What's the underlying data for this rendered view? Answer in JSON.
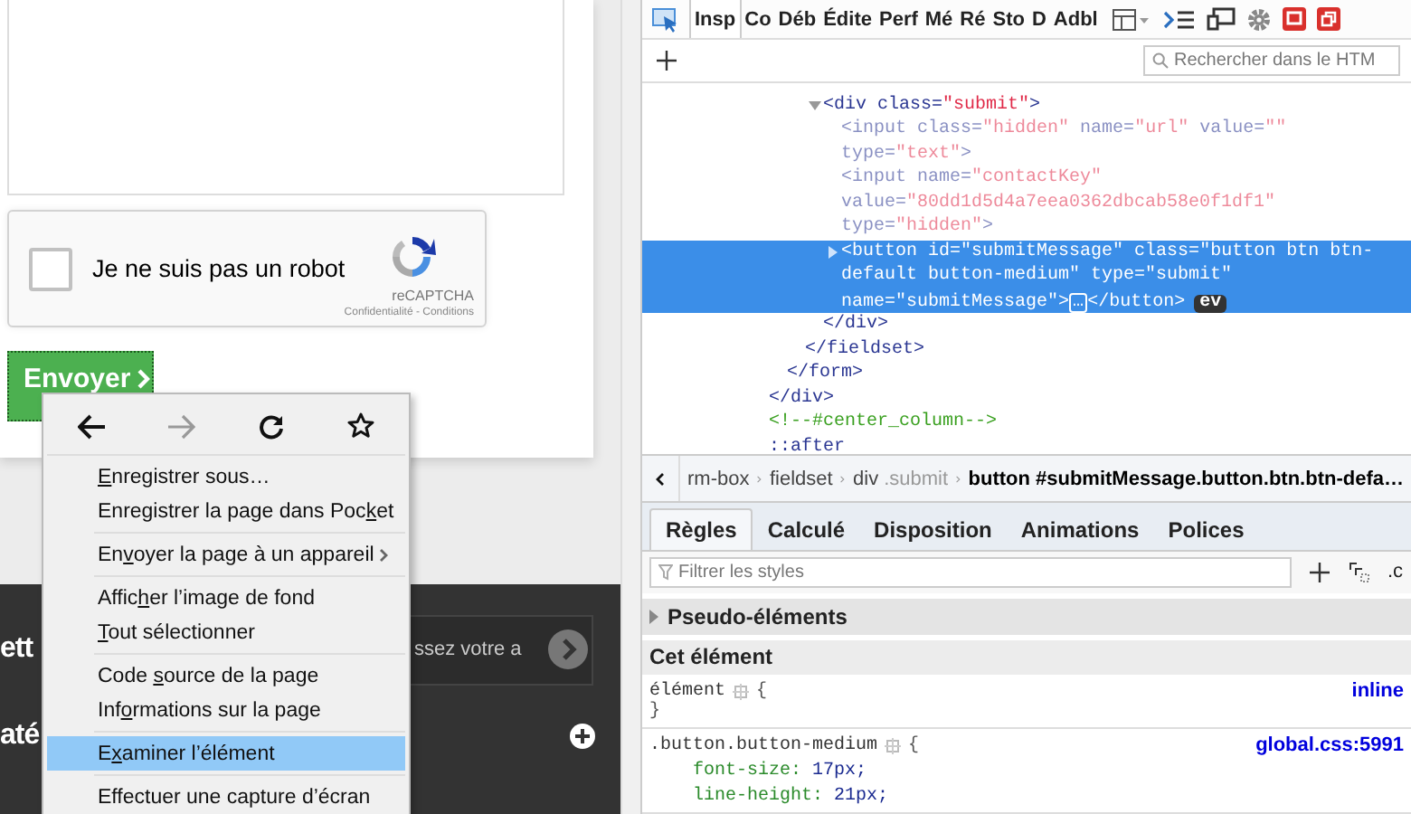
{
  "page": {
    "captcha": {
      "checked": false,
      "label": "Je ne suis pas un robot",
      "brand": "reCAPTCHA",
      "links": "Confidentialité - Conditions"
    },
    "submit_button": {
      "label": "Envoyer"
    },
    "footer": {
      "heading_1": "ett",
      "newsletter": {
        "value": "ssez votre a"
      },
      "heading_2": "até"
    }
  },
  "context_menu": {
    "nav": [
      {
        "kind": "back",
        "disabled": false
      },
      {
        "kind": "forward",
        "disabled": true
      },
      {
        "kind": "reload",
        "disabled": false
      },
      {
        "kind": "bookmark",
        "disabled": false
      }
    ],
    "groups": [
      [
        {
          "label": {
            "key": "E",
            "after": "nregistrer sous…"
          },
          "submenu": false,
          "selected": false
        },
        {
          "label": {
            "before": "Enregistrer la page dans Poc",
            "key": "k",
            "after": "et"
          },
          "submenu": false,
          "selected": false
        }
      ],
      [
        {
          "label": {
            "before": "En",
            "key": "v",
            "after": "oyer la page à un appareil"
          },
          "submenu": true,
          "selected": false
        }
      ],
      [
        {
          "label": {
            "before": "Affic",
            "key": "h",
            "after": "er l’image de fond"
          },
          "submenu": false,
          "selected": false
        },
        {
          "label": {
            "key": "T",
            "after": "out sélectionner"
          },
          "submenu": false,
          "selected": false
        }
      ],
      [
        {
          "label": {
            "before": "Code ",
            "key": "s",
            "after": "ource de la page"
          },
          "submenu": false,
          "selected": false
        },
        {
          "label": {
            "before": "Inf",
            "key": "o",
            "after": "rmations sur la page"
          },
          "submenu": false,
          "selected": false
        }
      ],
      [
        {
          "label": {
            "before": "E",
            "key": "x",
            "after": "aminer l’élément"
          },
          "submenu": false,
          "selected": true
        }
      ],
      [
        {
          "label": {
            "before": "Effectuer une capture d’écran"
          },
          "submenu": false,
          "selected": false
        }
      ]
    ]
  },
  "devtools": {
    "tabs": [
      {
        "label": "Insp",
        "selected": true
      },
      {
        "label": "Co",
        "selected": false
      },
      {
        "label": "Déb",
        "selected": false
      },
      {
        "label": "Édite",
        "selected": false
      },
      {
        "label": "Perf",
        "selected": false
      },
      {
        "label": "Mé",
        "selected": false
      },
      {
        "label": "Ré",
        "selected": false
      },
      {
        "label": "Sto",
        "selected": false
      },
      {
        "label": "D",
        "selected": false
      },
      {
        "label": "Adbl",
        "selected": false
      }
    ],
    "search": {
      "placeholder": "Rechercher dans le HTM"
    },
    "markup": {
      "children": [
        {
          "children": [
            {
              "children": [
                {
                  "children": [
                    {
                      "expanded": true,
                      "selected": false,
                      "lines": [
                        [
                          {
                            "kind": "tag",
                            "text": "<div"
                          },
                          {
                            "kind": "attr",
                            "text": " class="
                          },
                          {
                            "kind": "value",
                            "text": "\"submit\""
                          },
                          {
                            "kind": "tag",
                            "text": ">"
                          }
                        ]
                      ],
                      "children": [
                        {
                          "hidden": true,
                          "selected": false,
                          "lines": [
                            [
                              {
                                "kind": "tag",
                                "text": "<input"
                              },
                              {
                                "kind": "attr",
                                "text": " class="
                              },
                              {
                                "kind": "value",
                                "text": "\"hidden\""
                              },
                              {
                                "kind": "attr",
                                "text": " name="
                              },
                              {
                                "kind": "value",
                                "text": "\"url\""
                              },
                              {
                                "kind": "attr",
                                "text": " value="
                              },
                              {
                                "kind": "value",
                                "text": "\"\""
                              }
                            ],
                            [
                              {
                                "kind": "attr",
                                "text": "type="
                              },
                              {
                                "kind": "value",
                                "text": "\"text\""
                              },
                              {
                                "kind": "tag",
                                "text": ">"
                              }
                            ]
                          ]
                        },
                        {
                          "hidden": true,
                          "selected": false,
                          "lines": [
                            [
                              {
                                "kind": "tag",
                                "text": "<input"
                              },
                              {
                                "kind": "attr",
                                "text": " name="
                              },
                              {
                                "kind": "value",
                                "text": "\"contactKey\""
                              }
                            ],
                            [
                              {
                                "kind": "attr",
                                "text": "value="
                              },
                              {
                                "kind": "value",
                                "text": "\"80dd1d5d4a7eea0362dbcab58e0f1df1\""
                              }
                            ],
                            [
                              {
                                "kind": "attr",
                                "text": "type="
                              },
                              {
                                "kind": "value",
                                "text": "\"hidden\""
                              },
                              {
                                "kind": "tag",
                                "text": ">"
                              }
                            ]
                          ]
                        },
                        {
                          "expanded": false,
                          "selected": true,
                          "lines": [
                            [
                              {
                                "kind": "tag",
                                "text": "<button"
                              },
                              {
                                "kind": "attr",
                                "text": " id="
                              },
                              {
                                "kind": "value",
                                "text": "\"submitMessage\""
                              },
                              {
                                "kind": "attr",
                                "text": " class="
                              },
                              {
                                "kind": "value",
                                "text": "\"button btn btn-"
                              }
                            ],
                            [
                              {
                                "kind": "value",
                                "text": "default button-medium\""
                              },
                              {
                                "kind": "attr",
                                "text": " type="
                              },
                              {
                                "kind": "value",
                                "text": "\"submit\""
                              }
                            ],
                            [
                              {
                                "kind": "attr",
                                "text": "name="
                              },
                              {
                                "kind": "value",
                                "text": "\"submitMessage\""
                              },
                              {
                                "kind": "tag",
                                "text": ">"
                              },
                              {
                                "kind": "ellipsis",
                                "text": "…"
                              },
                              {
                                "kind": "tag",
                                "text": "</button>"
                              },
                              {
                                "kind": "event",
                                "text": "ev"
                              }
                            ]
                          ]
                        }
                      ],
                      "close": [
                        {
                          "kind": "tag",
                          "text": "</div>"
                        }
                      ]
                    }
                  ],
                  "close": [
                    {
                      "kind": "tag",
                      "text": "</fieldset>"
                    }
                  ]
                }
              ],
              "close": [
                {
                  "kind": "tag",
                  "text": "</form>"
                }
              ]
            }
          ],
          "close": [
            {
              "kind": "tag",
              "text": "</div>"
            }
          ]
        },
        {
          "selected": false,
          "lines": [
            [
              {
                "kind": "comment",
                "text": "<!--#center_column-->"
              }
            ]
          ]
        },
        {
          "selected": false,
          "lines": [
            [
              {
                "kind": "pseudo",
                "text": "::after"
              }
            ]
          ]
        }
      ]
    },
    "breadcrumbs": [
      {
        "name": "rm-box",
        "selected": false
      },
      {
        "name": "fieldset",
        "selected": false
      },
      {
        "name": "div",
        "classes": ".submit",
        "selected": false
      },
      {
        "name": "button",
        "classes": "#submitMessage.button.btn.btn-defa…",
        "selected": true
      }
    ],
    "rule_tabs": [
      {
        "label": "Règles",
        "selected": true
      },
      {
        "label": "Calculé",
        "selected": false
      },
      {
        "label": "Disposition",
        "selected": false
      },
      {
        "label": "Animations",
        "selected": false
      },
      {
        "label": "Polices",
        "selected": false
      }
    ],
    "filter": {
      "placeholder": "Filtrer les styles",
      "class_toggle": ".c"
    },
    "sections": [
      {
        "title": "Pseudo-éléments",
        "kind": "collapsible",
        "expanded": false
      },
      {
        "title": "Cet élément",
        "kind": "header"
      }
    ],
    "rules": [
      {
        "selector": "élément",
        "open": "{",
        "source": "inline",
        "close": "}"
      },
      {
        "selector": ".button.button-medium",
        "open": "{",
        "source": "global.css:5991",
        "declarations": [
          {
            "property": "font-size:",
            "value": "17px;"
          },
          {
            "property": "line-height:",
            "value": "21px;"
          }
        ]
      }
    ]
  }
}
